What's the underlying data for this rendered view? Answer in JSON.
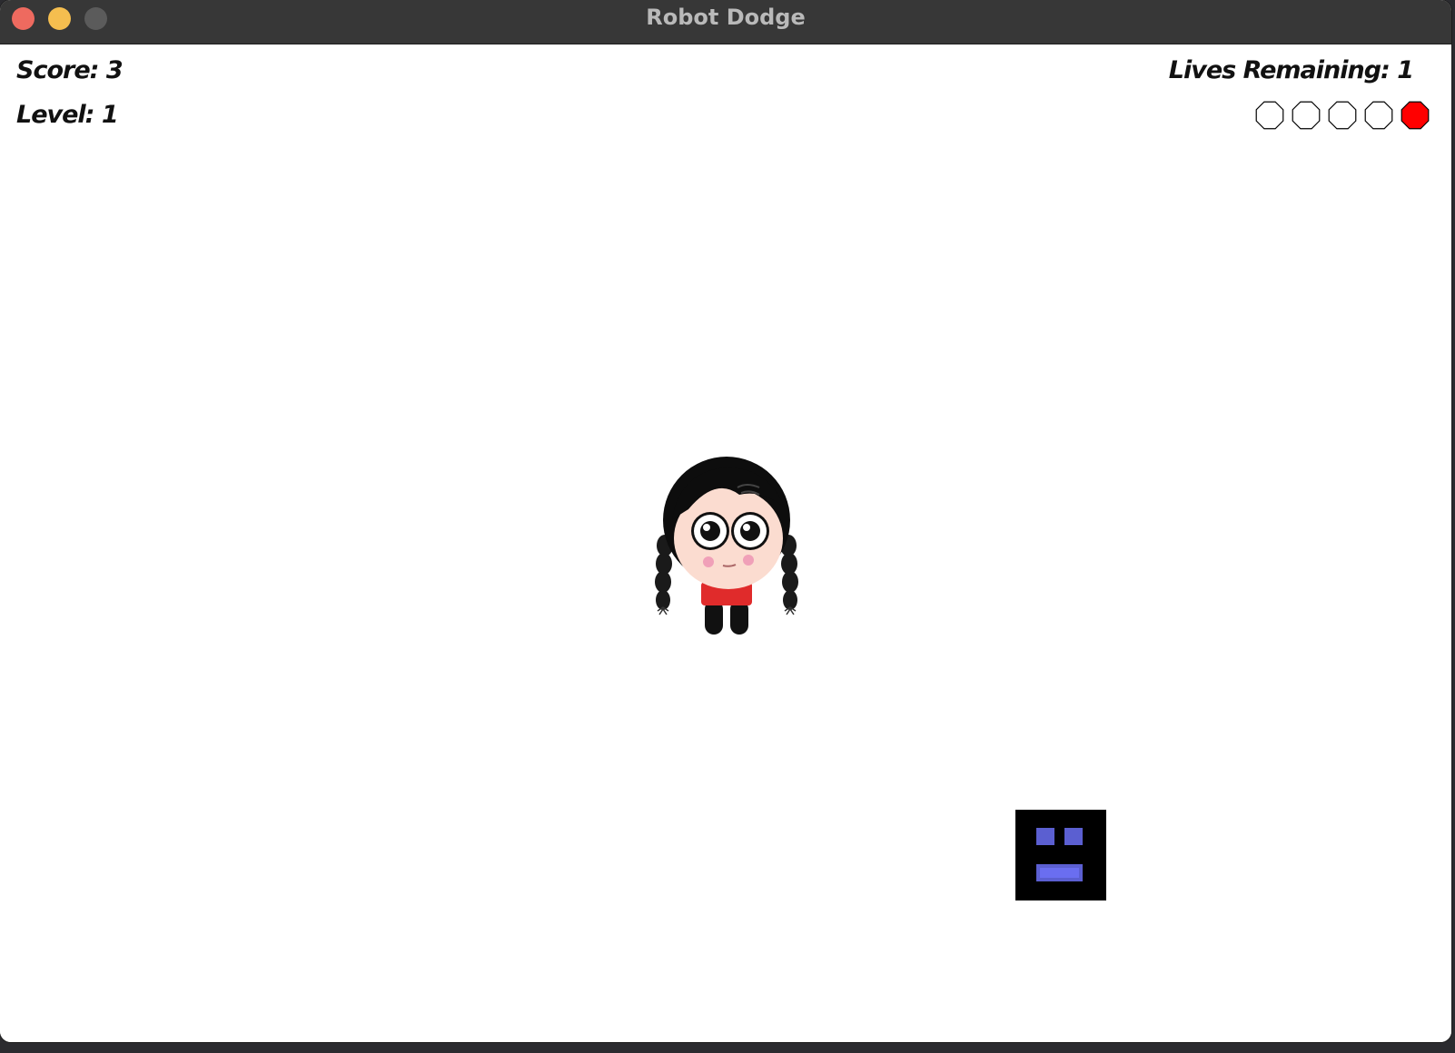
{
  "window": {
    "title": "Robot Dodge"
  },
  "hud": {
    "score_text": "Score: 3",
    "level_text": "Level: 1",
    "lives_text": "Lives Remaining: 1"
  },
  "game_state": {
    "score": 3,
    "level": 1,
    "lives_remaining": 1,
    "lives_max": 5
  },
  "colors": {
    "life_full": "#ff0000",
    "life_empty": "#ffffff",
    "robot_body": "#000000",
    "robot_features": "#5b5fd1"
  },
  "sprites": {
    "player": "girl-character-icon",
    "enemy": "robot-icon"
  }
}
